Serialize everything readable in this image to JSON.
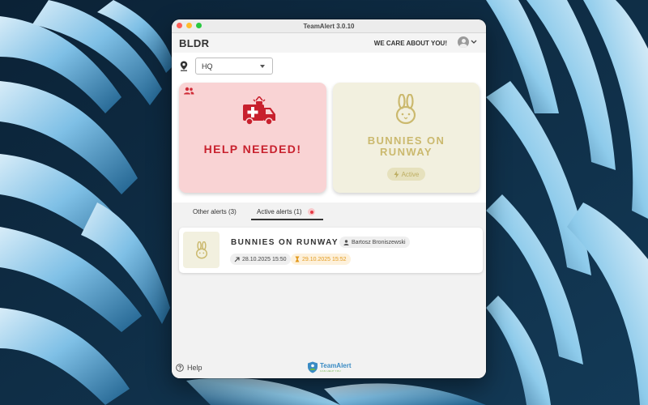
{
  "window": {
    "title": "TeamAlert 3.0.10"
  },
  "header": {
    "brand": "BLDR",
    "tagline": "WE CARE ABOUT YOU!"
  },
  "location": {
    "selected": "HQ"
  },
  "cards": [
    {
      "label": "HELP NEEDED!",
      "color": "#c8202d",
      "background": "#f9d3d4"
    },
    {
      "label_line1": "BUNNIES ON",
      "label_line2": "RUNWAY",
      "status": "Active",
      "color": "#cbb96e",
      "background": "#f2f0df"
    }
  ],
  "tabs": {
    "other": "Other alerts (3)",
    "active": "Active alerts (1)"
  },
  "alerts": [
    {
      "title": "BUNNIES ON RUNWAY",
      "author": "Bartosz Broniszewski",
      "started": "28.10.2025 15:50",
      "deadline": "29.10.2025 15:52"
    }
  ],
  "footer": {
    "help": "Help",
    "logo_word": "TeamAlert",
    "logo_sub": "CAN HELP YOU"
  },
  "icons": [
    "people-icon",
    "ambulance-icon",
    "rabbit-icon",
    "bolt-icon",
    "location-pin-icon",
    "person-icon",
    "arrow-up-right-icon",
    "hourglass-icon",
    "help-circle-icon",
    "avatar-icon",
    "chevron-down-icon"
  ]
}
